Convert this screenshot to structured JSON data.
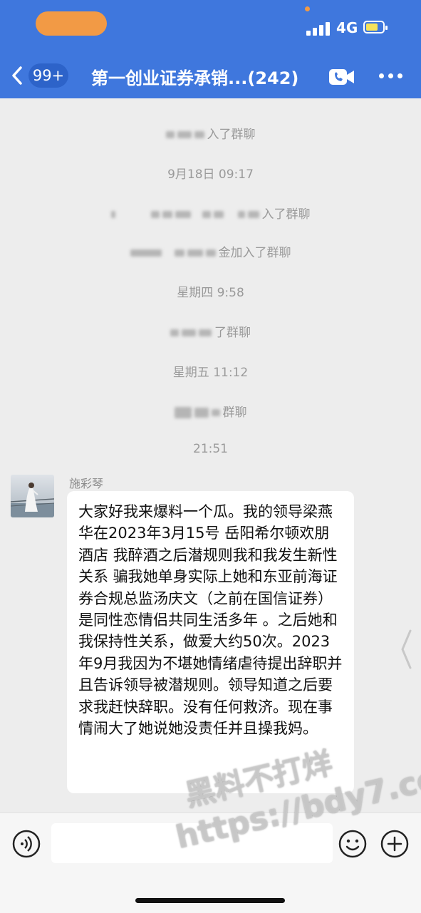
{
  "status_bar": {
    "network": "4G"
  },
  "header": {
    "back_badge": "99+",
    "title": "第一创业证券承销...(242)"
  },
  "chat": {
    "system_messages": [
      {
        "suffix": "入了群聊"
      },
      {
        "time": "9月18日 09:17"
      },
      {
        "suffix": "入了群聊"
      },
      {
        "suffix": "金加入了群聊"
      },
      {
        "time": "星期四 9:58"
      },
      {
        "suffix": "了群聊"
      },
      {
        "time": "星期五 11:12"
      },
      {
        "suffix": "群聊"
      },
      {
        "time": "21:51"
      }
    ],
    "message": {
      "sender": "施彩琴",
      "text": "大家好我来爆料一个瓜。我的领导梁燕华在2023年3月15号 岳阳希尔顿欢朋酒店 我醉酒之后潜规则我和我发生新性关系 骗我她单身实际上她和东亚前海证券合规总监汤庆文（之前在国信证券）是同性恋情侣共同生活多年 。之后她和我保持性关系，做爱大约50次。2023年9月我因为不堪她情绪虐待提出辞职并且告诉领导被潜规则。领导知道之后要求我赶快辞职。没有任何救济。现在事情闹大了她说她没责任并且操我妈。"
    }
  },
  "input_bar": {
    "placeholder": ""
  },
  "watermark": {
    "line1": "黑料不打烊",
    "line2": "https://bdy7.co"
  },
  "icons": {
    "back": "chevron-left-icon",
    "video": "video-call-icon",
    "more": "more-dots-icon",
    "voice": "voice-icon",
    "emoji": "emoji-icon",
    "plus": "plus-icon"
  },
  "colors": {
    "header_bg": "#3f77dd",
    "status_pill": "#f29a45",
    "chat_bg": "#ededed",
    "bubble_bg": "#ffffff"
  }
}
